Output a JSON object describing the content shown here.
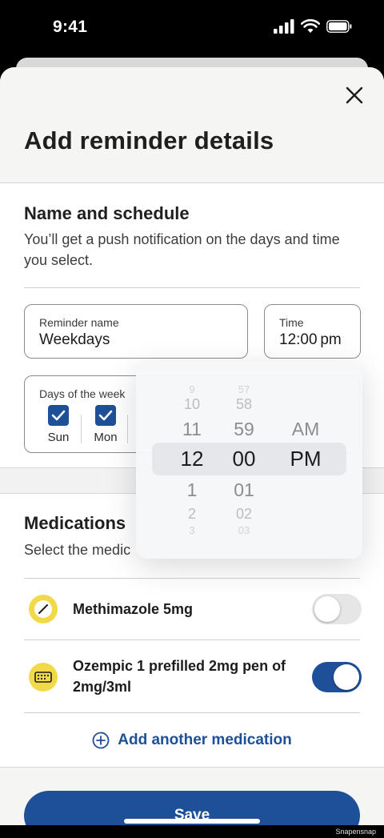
{
  "status": {
    "time": "9:41"
  },
  "header": {
    "title": "Add reminder details"
  },
  "schedule": {
    "title": "Name and schedule",
    "description": "You’ll get a push notification on the days and time you select.",
    "name_label": "Reminder name",
    "name_value": "Weekdays",
    "time_label": "Time",
    "time_value": "12:00 pm",
    "days_label": "Days of the week",
    "days": [
      {
        "label": "Sun",
        "checked": true
      },
      {
        "label": "Mon",
        "checked": true
      }
    ]
  },
  "picker": {
    "hours": [
      "9",
      "10",
      "11",
      "12",
      "1",
      "2",
      "3"
    ],
    "minutes": [
      "57",
      "58",
      "59",
      "00",
      "01",
      "02",
      "03"
    ],
    "periods": [
      "AM",
      "PM"
    ]
  },
  "medications": {
    "title": "Medications",
    "description": "Select the medic",
    "items": [
      {
        "name": "Methimazole 5mg",
        "icon": "pill-icon",
        "enabled": false
      },
      {
        "name": "Ozempic 1 prefilled 2mg pen of 2mg/3ml",
        "icon": "injection-pen-icon",
        "enabled": true
      }
    ],
    "add_label": "Add another medication"
  },
  "footer": {
    "save_label": "Save"
  },
  "watermark": "Snapensnap",
  "colors": {
    "primary": "#1e4f99",
    "pill_yellow": "#f1d94a"
  }
}
